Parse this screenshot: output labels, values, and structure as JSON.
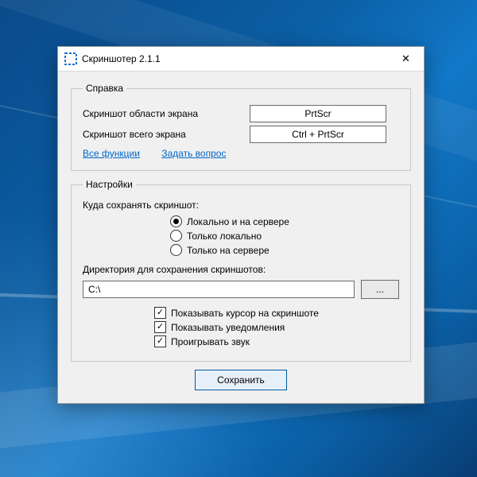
{
  "window": {
    "title": "Скриншотер 2.1.1"
  },
  "help": {
    "legend": "Справка",
    "rows": [
      {
        "label": "Скриншот области экрана",
        "hotkey": "PrtScr"
      },
      {
        "label": "Скриншот всего экрана",
        "hotkey": "Ctrl + PrtScr"
      }
    ],
    "link_all": "Все функции",
    "link_ask": "Задать вопрос"
  },
  "settings": {
    "legend": "Настройки",
    "save_where_label": "Куда сохранять скриншот:",
    "save_where_options": [
      {
        "label": "Локально и на сервере",
        "checked": true
      },
      {
        "label": "Только локально",
        "checked": false
      },
      {
        "label": "Только на сервере",
        "checked": false
      }
    ],
    "dir_label": "Директория для сохранения скриншотов:",
    "dir_value": "C:\\",
    "browse_label": "...",
    "checks": [
      {
        "label": "Показывать курсор на скриншоте",
        "checked": true
      },
      {
        "label": "Показывать уведомления",
        "checked": true
      },
      {
        "label": "Проигрывать звук",
        "checked": true
      }
    ]
  },
  "footer": {
    "save_label": "Сохранить"
  }
}
